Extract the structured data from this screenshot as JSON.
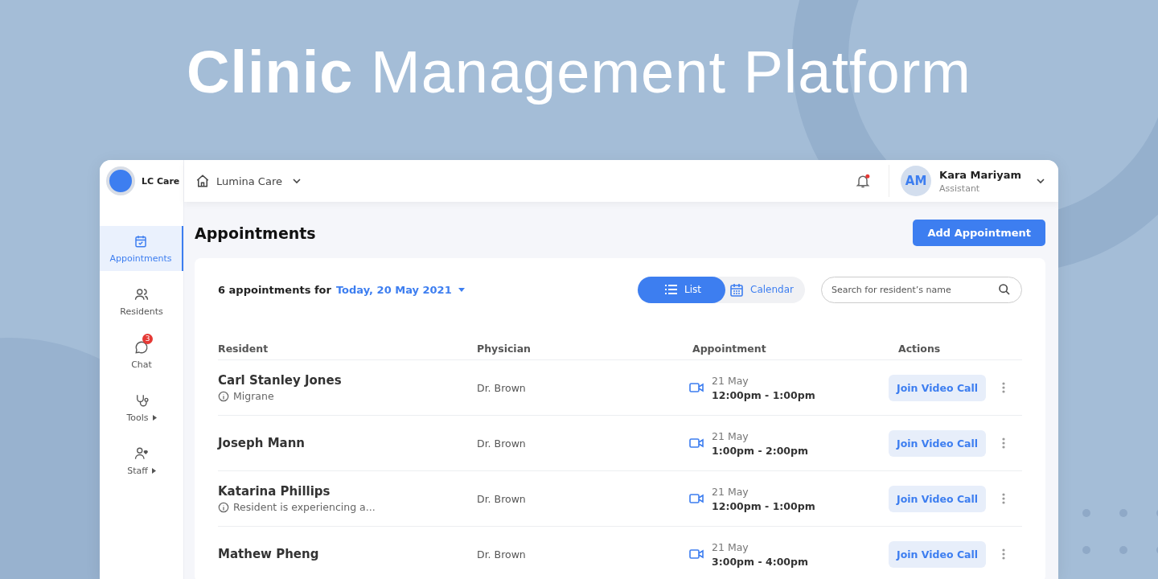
{
  "headline": "**Clinic** Management Platform",
  "app": {
    "logo_text": "LC Care",
    "location": "Lumina Care",
    "notification_unread": true,
    "user": {
      "initials": "AM",
      "name": "Kara Mariyam",
      "role": "Assistant"
    }
  },
  "sidebar": {
    "items": [
      {
        "label": "Appointments",
        "kind": "calendar",
        "selected": true,
        "submenu": false
      },
      {
        "label": "Residents",
        "kind": "people",
        "selected": false,
        "submenu": false
      },
      {
        "label": "Chat",
        "kind": "chat",
        "selected": false,
        "submenu": false,
        "badge": "3"
      },
      {
        "label": "Tools",
        "kind": "stethoscope",
        "selected": false,
        "submenu": true
      },
      {
        "label": "Staff",
        "kind": "staff",
        "selected": false,
        "submenu": true
      }
    ]
  },
  "page": {
    "title": "Appointments",
    "add_button": "Add Appointment",
    "summary": "6 appointments for",
    "date": "Today, 20 May 2021",
    "views": [
      {
        "label": "List",
        "kind": "list",
        "selected": true
      },
      {
        "label": "Calendar",
        "kind": "calendar",
        "selected": false
      }
    ],
    "search": {
      "placeholder": "Search for resident’s name"
    }
  },
  "table": {
    "columns": [
      "Resident",
      "Physician",
      "Appointment",
      "Actions"
    ],
    "rows": [
      {
        "name": "Carl Stanley Jones",
        "note": "Migrane",
        "physician": "Dr. Brown",
        "date": "21 May",
        "time": "12:00pm - 1:00pm",
        "action": "Join Video Call"
      },
      {
        "name": "Joseph Mann",
        "physician": "Dr. Brown",
        "date": "21 May",
        "time": "1:00pm - 2:00pm",
        "action": "Join Video Call"
      },
      {
        "name": "Katarina Phillips",
        "note": "Resident is experiencing a...",
        "physician": "Dr. Brown",
        "date": "21 May",
        "time": "12:00pm - 1:00pm",
        "action": "Join Video Call"
      },
      {
        "name": "Mathew Pheng",
        "physician": "Dr. Brown",
        "date": "21 May",
        "time": "3:00pm - 4:00pm",
        "action": "Join Video Call"
      }
    ]
  }
}
